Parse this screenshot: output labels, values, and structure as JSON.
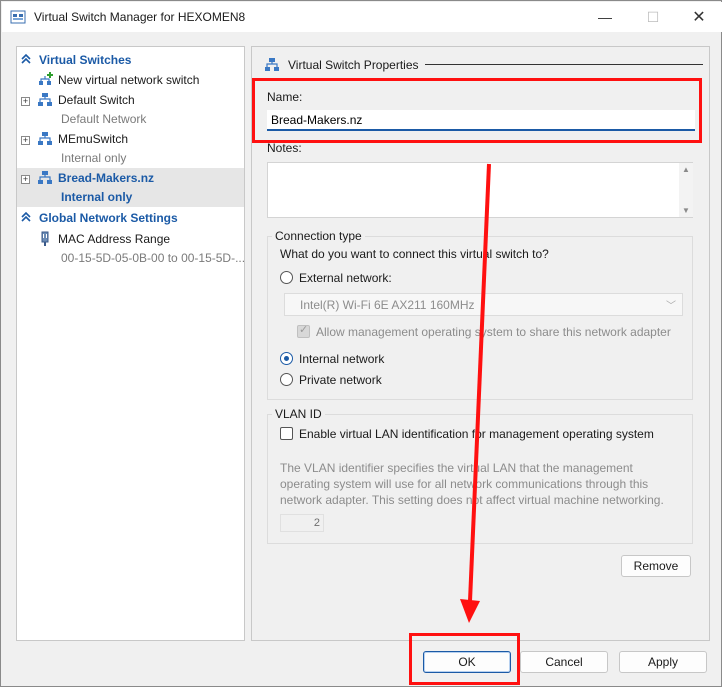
{
  "window": {
    "title": "Virtual Switch Manager for HEXOMEN8",
    "controls": {
      "minimize": "—",
      "maximize": "☐",
      "close": "✕"
    }
  },
  "left_pane": {
    "virtual_switches_header": "Virtual Switches",
    "items": [
      {
        "label": "New virtual network switch",
        "sub": ""
      },
      {
        "label": "Default Switch",
        "sub": "Default Network"
      },
      {
        "label": "MEmuSwitch",
        "sub": "Internal only"
      },
      {
        "label": "Bread-Makers.nz",
        "sub": "Internal only"
      }
    ],
    "global_header": "Global Network Settings",
    "mac": {
      "label": "MAC Address Range",
      "sub": "00-15-5D-05-0B-00 to 00-15-5D-..."
    },
    "expander_symbol": "+"
  },
  "properties": {
    "header": "Virtual Switch Properties",
    "name_label": "Name:",
    "name_value": "Bread-Makers.nz",
    "notes_label": "Notes:",
    "notes_value": "",
    "connection_type": {
      "title": "Connection type",
      "question": "What do you want to connect this virtual switch to?",
      "external": "External network:",
      "adapter": "Intel(R) Wi-Fi 6E AX211 160MHz",
      "allow_mgmt": "Allow management operating system to share this network adapter",
      "internal": "Internal network",
      "private": "Private network",
      "selected": "internal"
    },
    "vlan": {
      "title": "VLAN ID",
      "enable_label": "Enable virtual LAN identification for management operating system",
      "description": "The VLAN identifier specifies the virtual LAN that the management operating system will use for all network communications through this network adapter. This setting does not affect virtual machine networking.",
      "value": "2"
    },
    "remove_label": "Remove"
  },
  "footer": {
    "ok_label": "OK",
    "cancel_label": "Cancel",
    "apply_label": "Apply"
  },
  "colors": {
    "accent": "#1b5aa6",
    "annotation": "#ff1010"
  }
}
